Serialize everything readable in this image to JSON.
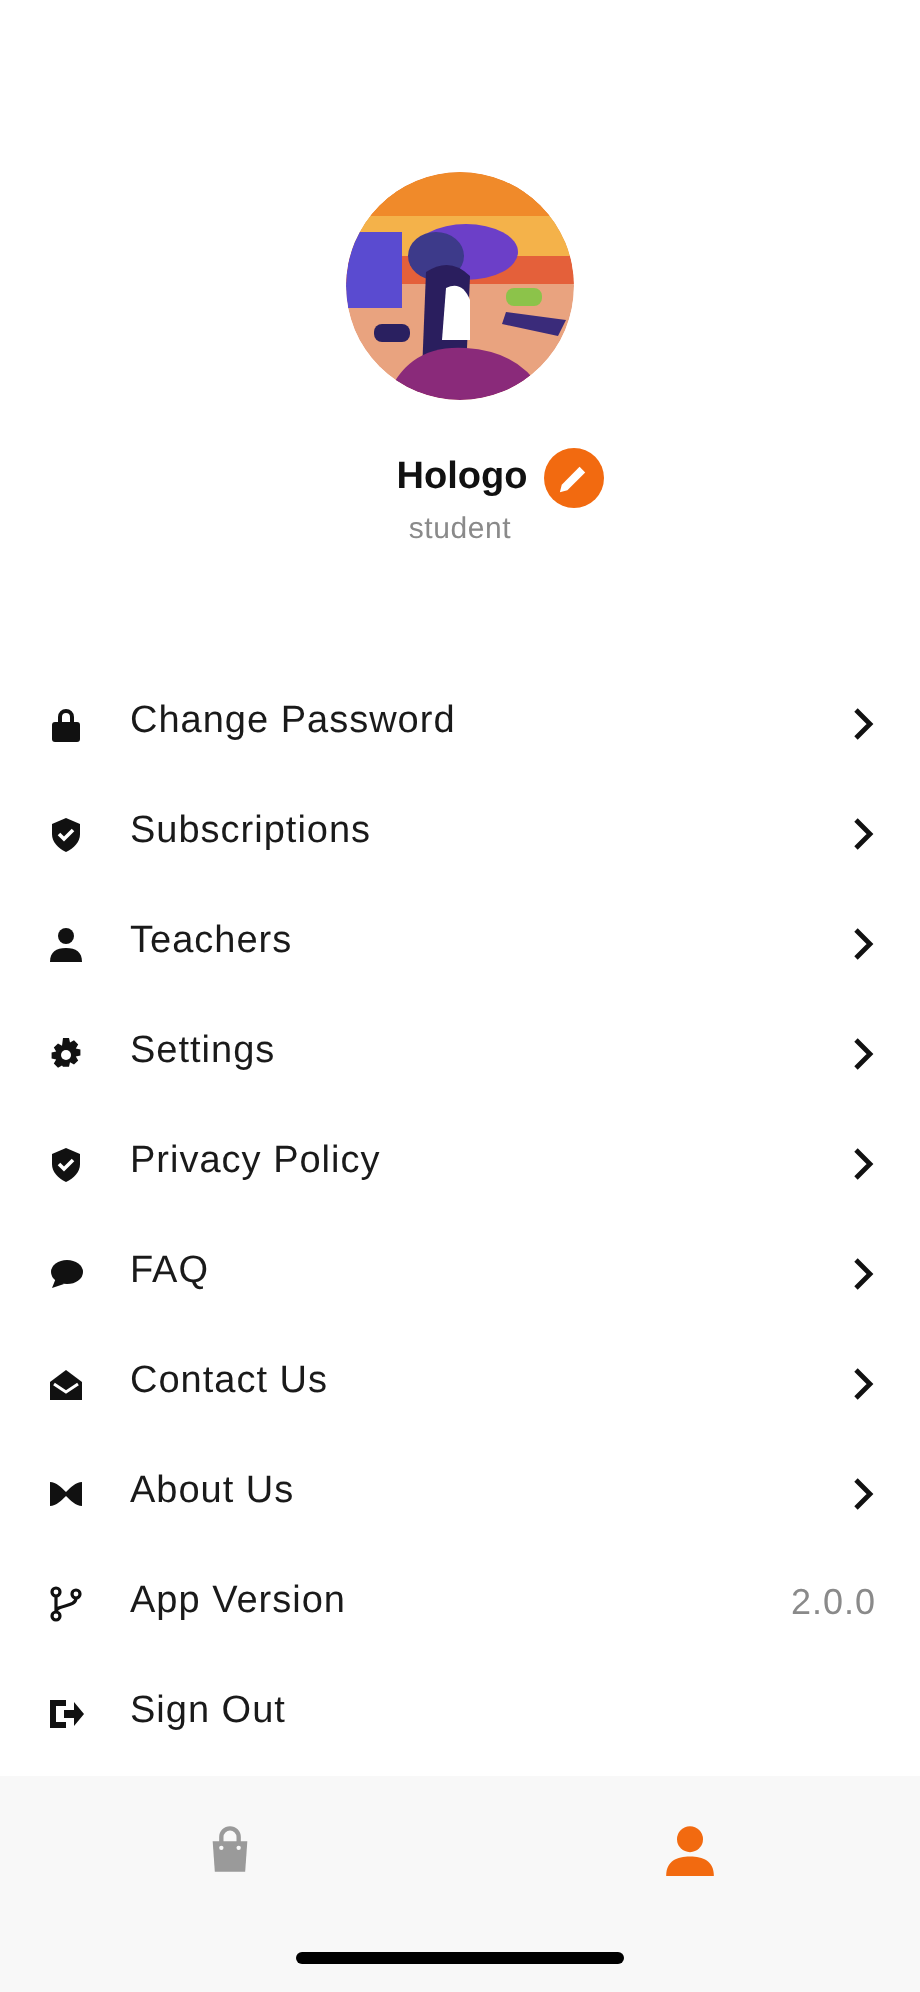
{
  "profile": {
    "name": "Hologo",
    "role": "student"
  },
  "menu": [
    {
      "label": "Change Password",
      "kind": "link"
    },
    {
      "label": "Subscriptions",
      "kind": "link"
    },
    {
      "label": "Teachers",
      "kind": "link"
    },
    {
      "label": "Settings",
      "kind": "link"
    },
    {
      "label": "Privacy Policy",
      "kind": "link"
    },
    {
      "label": "FAQ",
      "kind": "link"
    },
    {
      "label": "Contact Us",
      "kind": "link"
    },
    {
      "label": "About Us",
      "kind": "link"
    },
    {
      "label": "App Version",
      "kind": "value",
      "value": "2.0.0"
    },
    {
      "label": "Sign Out",
      "kind": "action"
    }
  ],
  "tab_bar": [
    {
      "selected": false
    },
    {
      "selected": true
    }
  ]
}
